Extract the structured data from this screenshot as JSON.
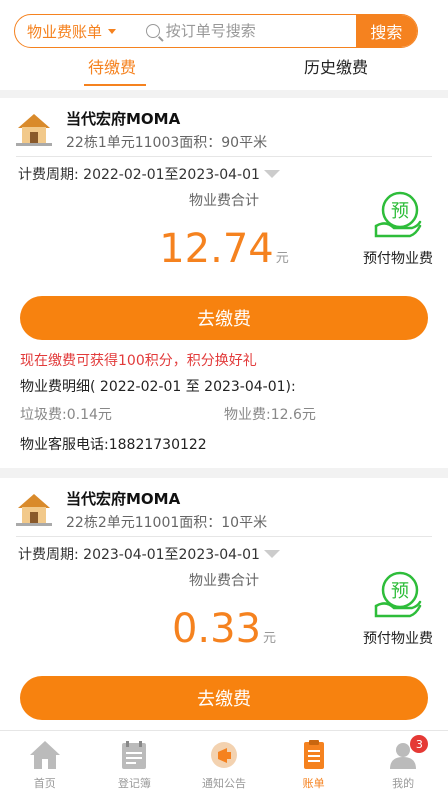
{
  "search": {
    "bill_type": "物业费账单",
    "placeholder": "按订单号搜索",
    "button": "搜索"
  },
  "tabs": [
    {
      "label": "待缴费",
      "active": true
    },
    {
      "label": "历史缴费",
      "active": false
    }
  ],
  "bills": [
    {
      "community": "当代宏府MOMA",
      "unit": "22栋1单元11003面积：90平米",
      "period": "计费周期: 2022-02-01至2023-04-01",
      "total_label": "物业费合计",
      "amount": "12.74",
      "currency": "元",
      "prepay_label": "预付物业费",
      "prepay_glyph": "预",
      "pay_button": "去缴费",
      "promo": "现在缴费可获得100积分，积分换好礼",
      "detail_title": "物业费明细( 2022-02-01 至 2023-04-01):",
      "fees": [
        "垃圾费:0.14元",
        "物业费:12.6元"
      ],
      "phone": "物业客服电话:18821730122"
    },
    {
      "community": "当代宏府MOMA",
      "unit": "22栋2单元11001面积：10平米",
      "period": "计费周期: 2023-04-01至2023-04-01",
      "total_label": "物业费合计",
      "amount": "0.33",
      "currency": "元",
      "prepay_label": "预付物业费",
      "prepay_glyph": "预",
      "pay_button": "去缴费"
    }
  ],
  "nav": {
    "items": [
      {
        "label": "首页",
        "icon": "home-icon"
      },
      {
        "label": "登记簿",
        "icon": "register-icon"
      },
      {
        "label": "通知公告",
        "icon": "notice-icon"
      },
      {
        "label": "账单",
        "icon": "bill-icon",
        "active": true
      },
      {
        "label": "我的",
        "icon": "user-icon",
        "badge": "3"
      }
    ]
  },
  "colors": {
    "accent": "#f5821f",
    "promo": "#e23b3b",
    "prepay_green": "#2ebd3a"
  }
}
